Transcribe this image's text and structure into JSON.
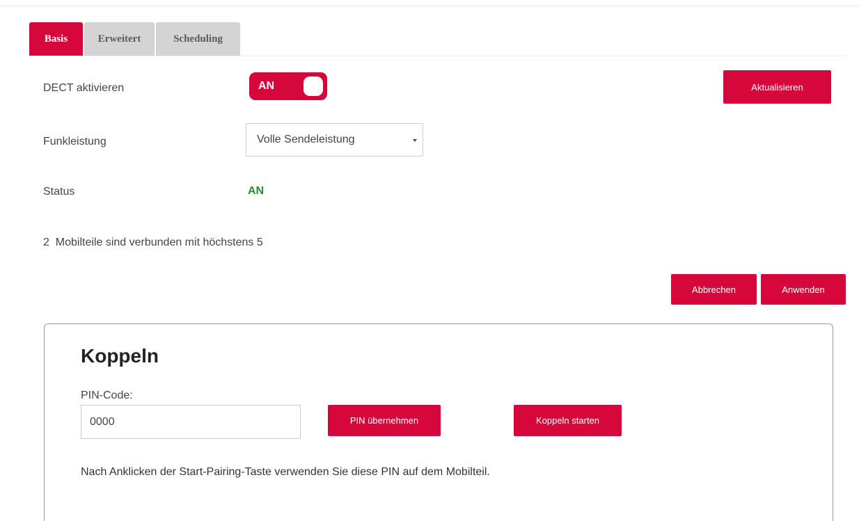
{
  "tabs": [
    {
      "label": "Basis",
      "active": true
    },
    {
      "label": "Erweitert",
      "active": false
    },
    {
      "label": "Scheduling",
      "active": false
    }
  ],
  "dect": {
    "label": "DECT aktivieren",
    "toggle_label": "AN",
    "enabled": true
  },
  "refresh_button": "Aktualisieren",
  "funkleistung": {
    "label": "Funkleistung",
    "selected": "Volle Sendeleistung"
  },
  "status": {
    "label": "Status",
    "value": "AN"
  },
  "handsets_info": "2  Mobilteile sind verbunden mit höchstens 5",
  "actions": {
    "cancel": "Abbrechen",
    "apply": "Anwenden"
  },
  "koppeln": {
    "title": "Koppeln",
    "pin_label": "PIN-Code:",
    "pin_value": "0000",
    "apply_pin": "PIN übernehmen",
    "start_pairing": "Koppeln starten",
    "note": "Nach Anklicken der Start-Pairing-Taste verwenden Sie diese PIN auf dem Mobilteil."
  },
  "colors": {
    "accent": "#d6083b",
    "status_on": "#2e8b2e",
    "tab_inactive": "#d4d4d4"
  }
}
